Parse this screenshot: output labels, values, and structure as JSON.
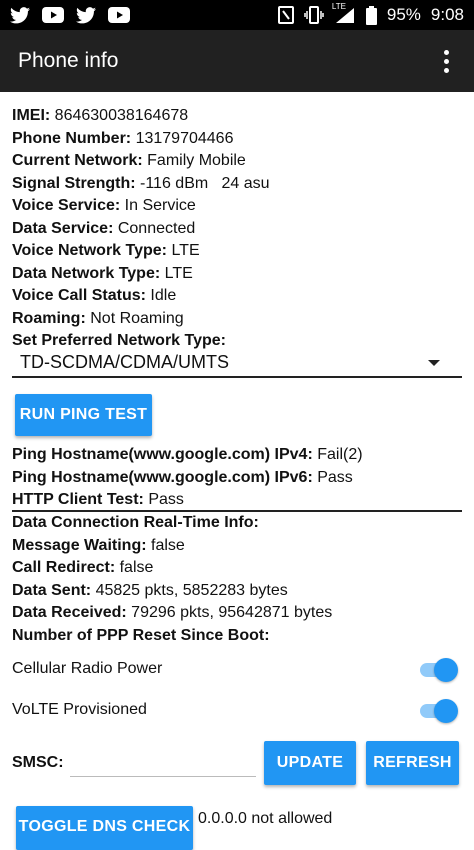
{
  "status_bar": {
    "left_icons": [
      "twitter-icon",
      "youtube-icon",
      "twitter-icon",
      "youtube-icon"
    ],
    "right_icons": [
      "nfc-icon",
      "vibrate-icon",
      "lte-signal-icon",
      "battery-icon"
    ],
    "lte_label": "LTE",
    "battery": "95%",
    "time": "9:08"
  },
  "appbar": {
    "title": "Phone info"
  },
  "info_rows": [
    {
      "label": "IMEI:",
      "value": "864630038164678"
    },
    {
      "label": "Phone Number:",
      "value": "13179704466"
    },
    {
      "label": "Current Network:",
      "value": "Family Mobile"
    },
    {
      "label": "Signal Strength:",
      "value": "-116 dBm   24 asu"
    },
    {
      "label": "Voice Service:",
      "value": "In Service"
    },
    {
      "label": "Data Service:",
      "value": "Connected"
    },
    {
      "label": "Voice Network Type:",
      "value": "LTE"
    },
    {
      "label": "Data Network Type:",
      "value": "LTE"
    },
    {
      "label": "Voice Call Status:",
      "value": "Idle"
    },
    {
      "label": "Roaming:",
      "value": "Not Roaming"
    },
    {
      "label": "Set Preferred Network Type:",
      "value": ""
    }
  ],
  "preferred_network": {
    "selected": "TD-SCDMA/CDMA/UMTS"
  },
  "run_ping_button": "RUN PING TEST",
  "ping_rows": [
    {
      "label": "Ping Hostname(www.google.com) IPv4:",
      "value": "Fail(2)"
    },
    {
      "label": "Ping Hostname(www.google.com) IPv6:",
      "value": "Pass"
    },
    {
      "label": "HTTP Client Test:",
      "value": "Pass"
    }
  ],
  "data_rows": [
    {
      "label": "Data Connection Real-Time Info:",
      "value": ""
    },
    {
      "label": "Message Waiting:",
      "value": "false"
    },
    {
      "label": "Call Redirect:",
      "value": "false"
    },
    {
      "label": "Data Sent:",
      "value": "45825 pkts, 5852283 bytes"
    },
    {
      "label": "Data Received:",
      "value": "79296 pkts, 95642871 bytes"
    },
    {
      "label": "Number of PPP Reset Since Boot:",
      "value": ""
    }
  ],
  "toggles": [
    {
      "label": "Cellular Radio Power",
      "on": true
    },
    {
      "label": "VoLTE Provisioned",
      "on": true
    }
  ],
  "smsc": {
    "label": "SMSC:",
    "value": "",
    "update": "UPDATE",
    "refresh": "REFRESH"
  },
  "dns": {
    "button": "TOGGLE DNS CHECK",
    "status": "0.0.0.0 not allowed"
  },
  "colors": {
    "accent": "#2196f3",
    "appbar": "#212121",
    "statusbar": "#000000"
  }
}
